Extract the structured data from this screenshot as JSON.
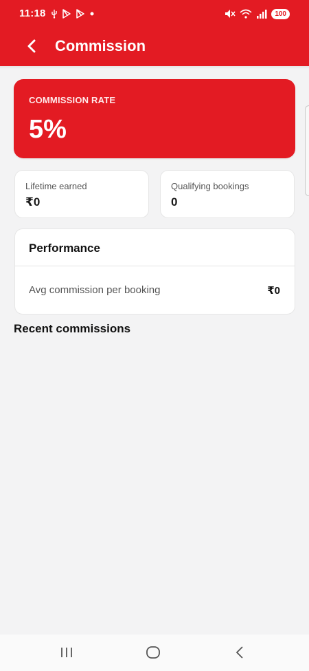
{
  "status_bar": {
    "time": "11:18",
    "left_icons": [
      "usb-icon",
      "play-icon",
      "play-icon",
      "dot-icon"
    ],
    "right_icons": [
      "mute-icon",
      "wifi-icon",
      "signal-icon"
    ],
    "battery": "100"
  },
  "header": {
    "title": "Commission",
    "back_icon": "chevron-left-icon",
    "background": "#e31b23"
  },
  "rate_card": {
    "label": "COMMISSION RATE",
    "value": "5%"
  },
  "stats": {
    "lifetime_label": "Lifetime earned",
    "lifetime_value": "₹0",
    "bookings_label": "Qualifying bookings",
    "bookings_value": "0"
  },
  "performance": {
    "title": "Performance",
    "avg_label": "Avg commission per booking",
    "avg_value": "₹0"
  },
  "recent": {
    "title": "Recent commissions"
  },
  "nav": {
    "icons": [
      "recents-icon",
      "home-icon",
      "back-icon"
    ]
  }
}
